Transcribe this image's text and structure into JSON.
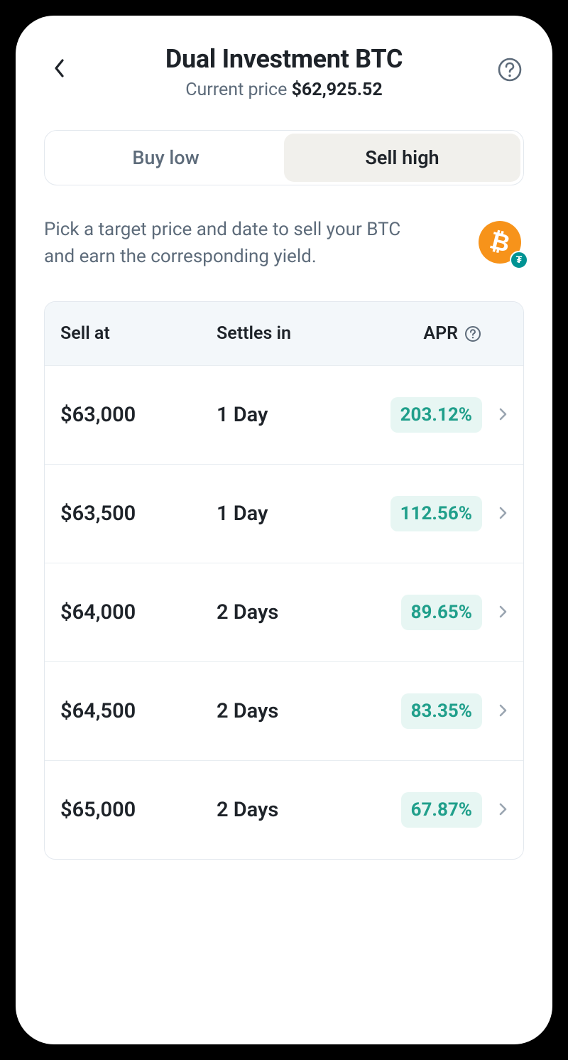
{
  "header": {
    "title": "Dual Investment BTC",
    "subtitle_label": "Current price",
    "current_price": "$62,925.52"
  },
  "tabs": {
    "buy_low": "Buy low",
    "sell_high": "Sell high",
    "active": "sell_high"
  },
  "description": "Pick a target price and date to sell your BTC and earn the corresponding yield.",
  "coin": {
    "main_symbol": "₿",
    "badge_symbol": "₮"
  },
  "table": {
    "columns": {
      "sell_at": "Sell at",
      "settles_in": "Settles in",
      "apr": "APR"
    },
    "rows": [
      {
        "price": "$63,000",
        "settles": "1 Day",
        "apr": "203.12%"
      },
      {
        "price": "$63,500",
        "settles": "1 Day",
        "apr": "112.56%"
      },
      {
        "price": "$64,000",
        "settles": "2 Days",
        "apr": "89.65%"
      },
      {
        "price": "$64,500",
        "settles": "2 Days",
        "apr": "83.35%"
      },
      {
        "price": "$65,000",
        "settles": "2 Days",
        "apr": "67.87%"
      }
    ]
  }
}
